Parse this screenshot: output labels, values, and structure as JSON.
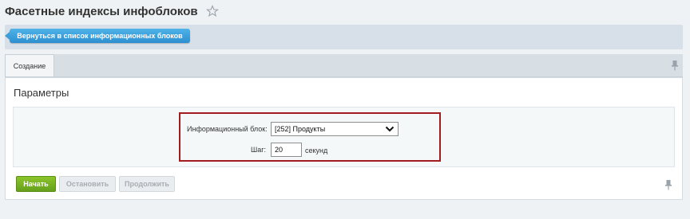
{
  "header": {
    "title": "Фасетные индексы инфоблоков",
    "favorite_icon": "star-icon"
  },
  "context": {
    "back_label": "Вернуться в список информационных блоков"
  },
  "tabs": [
    {
      "label": "Создание",
      "active": true
    }
  ],
  "panel": {
    "title": "Параметры",
    "form": {
      "iblock_label": "Информационный блок:",
      "iblock_value": "[252] Продукты",
      "step_label": "Шаг:",
      "step_value": "20",
      "step_unit": "секунд"
    },
    "buttons": {
      "start": "Начать",
      "stop": "Остановить",
      "continue": "Продолжить"
    }
  },
  "colors": {
    "accent_blue": "#2d8fd0",
    "start_green": "#72ab1f",
    "highlight_red": "#a31a1f"
  }
}
